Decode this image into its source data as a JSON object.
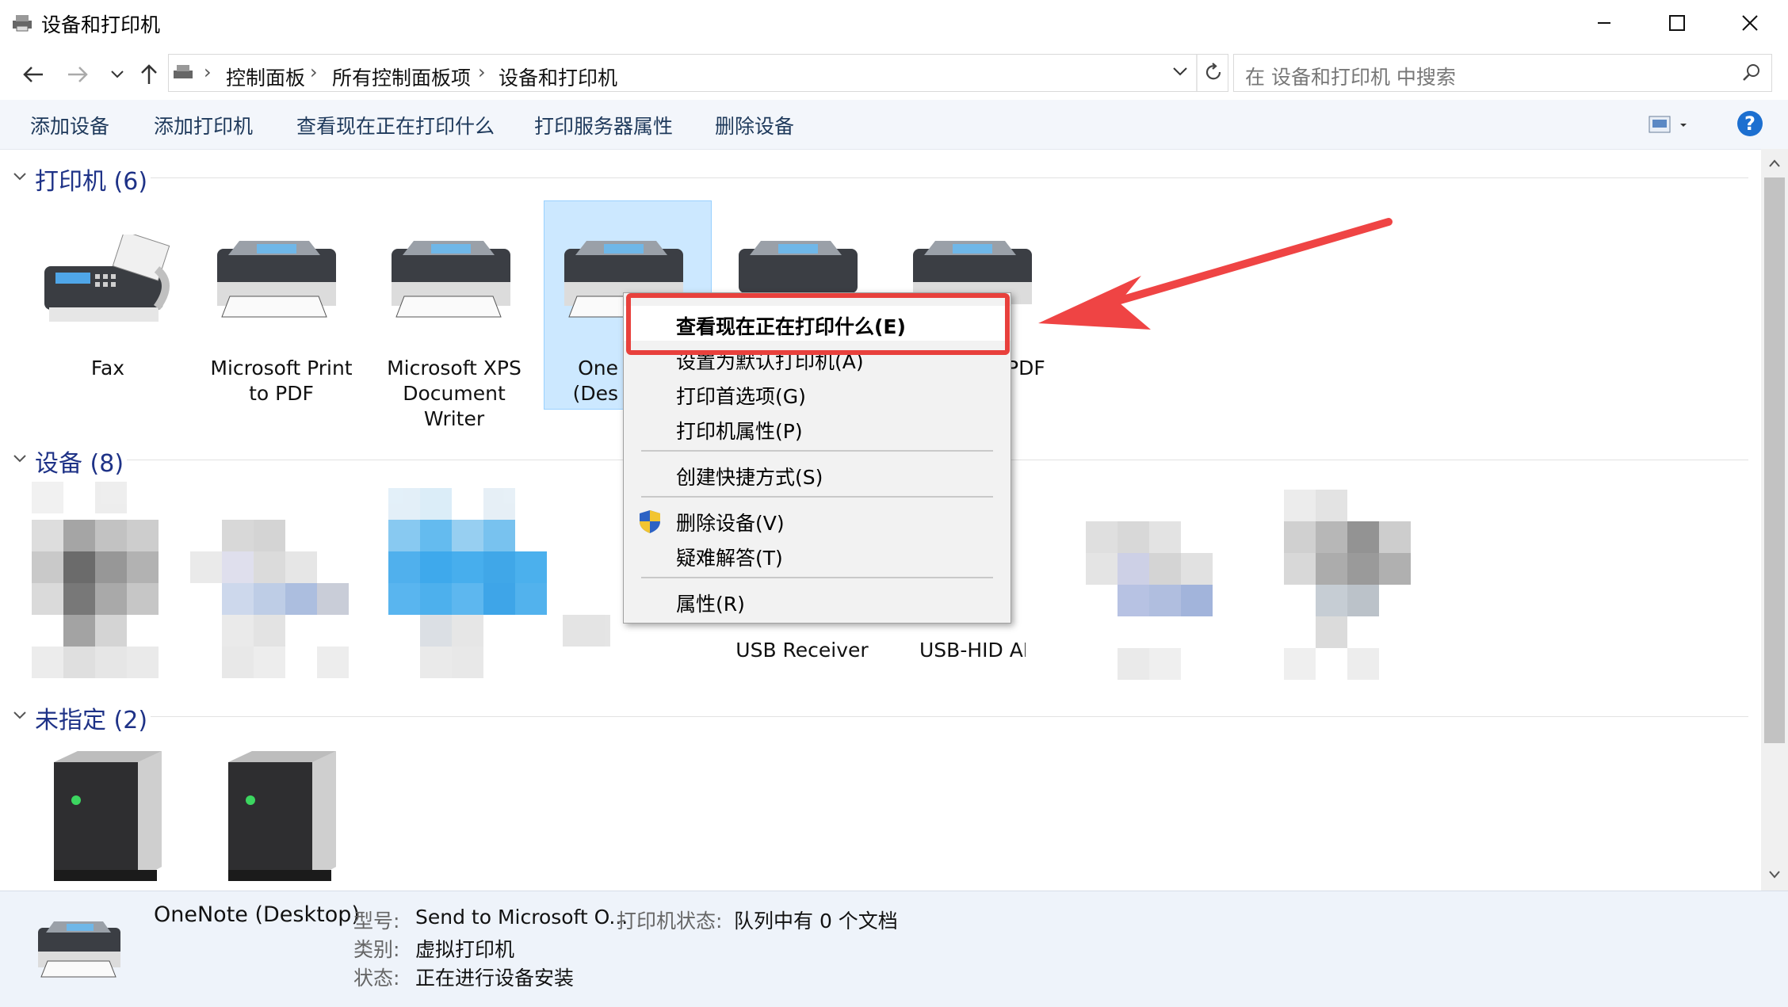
{
  "window": {
    "title": "设备和打印机"
  },
  "address": {
    "crumbs": [
      "控制面板",
      "所有控制面板项",
      "设备和打印机"
    ],
    "search_placeholder": "在 设备和打印机 中搜索"
  },
  "toolbar": {
    "add_device": "添加设备",
    "add_printer": "添加打印机",
    "see_printing": "查看现在正在打印什么",
    "print_server": "打印服务器属性",
    "remove_device": "删除设备",
    "help": "?"
  },
  "groups": {
    "printers": "打印机 (6)",
    "devices": "设备 (8)",
    "unspecified": "未指定 (2)"
  },
  "printers": [
    {
      "line1": "Fax",
      "line2": "",
      "line3": ""
    },
    {
      "line1": "Microsoft Print",
      "line2": "to PDF",
      "line3": ""
    },
    {
      "line1": "Microsoft XPS",
      "line2": "Document",
      "line3": "Writer"
    },
    {
      "line1": "One",
      "line2": "(Des",
      "line3": ""
    },
    {
      "line1": "PDF",
      "line2": "",
      "line3": ""
    }
  ],
  "devices": {
    "usb_receiver": "USB Receiver",
    "usb_hid": "USB-HID AI"
  },
  "context_menu": {
    "see_printing": "查看现在正在打印什么(E)",
    "set_default": "设置为默认打印机(A)",
    "prefs": "打印首选项(G)",
    "printer_props": "打印机属性(P)",
    "shortcut": "创建快捷方式(S)",
    "remove": "删除设备(V)",
    "troubleshoot": "疑难解答(T)",
    "properties": "属性(R)"
  },
  "details": {
    "name": "OneNote (Desktop)",
    "model_label": "型号:",
    "model_value": "Send to Microsoft O...",
    "status_label": "打印机状态:",
    "status_value": "队列中有 0 个文档",
    "category_label": "类别:",
    "category_value": "虚拟打印机",
    "state_label": "状态:",
    "state_value": "正在进行设备安装"
  },
  "colors": {
    "accent": "#1e3287",
    "highlight": "#e8403c",
    "selection": "#cce8ff"
  }
}
